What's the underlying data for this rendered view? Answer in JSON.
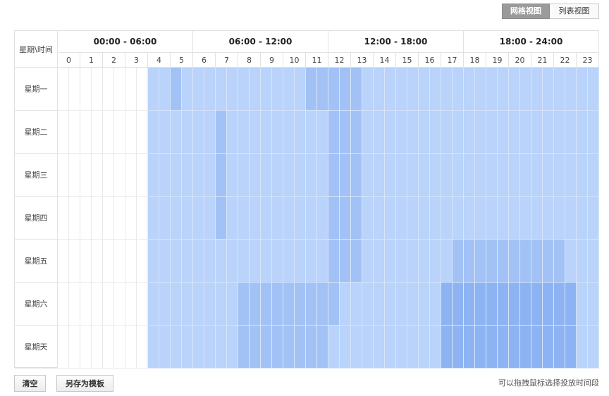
{
  "view_toggle": {
    "grid_label": "网格视图",
    "list_label": "列表视图"
  },
  "grid": {
    "corner_label": "星期\\时间",
    "groups": [
      "00:00 - 06:00",
      "06:00 - 12:00",
      "12:00 - 18:00",
      "18:00 - 24:00"
    ],
    "hours": [
      "0",
      "1",
      "2",
      "3",
      "4",
      "5",
      "6",
      "7",
      "8",
      "9",
      "10",
      "11",
      "12",
      "13",
      "14",
      "15",
      "16",
      "17",
      "18",
      "19",
      "20",
      "21",
      "22",
      "23"
    ],
    "days": [
      "星期一",
      "星期二",
      "星期三",
      "星期四",
      "星期五",
      "星期六",
      "星期天"
    ],
    "shade_levels": {
      "0": "#ffffff",
      "1": "#b9d3fa",
      "2": "#a2c2f6",
      "3": "#8db3f3"
    },
    "shading": [
      [
        0,
        0,
        0,
        0,
        0,
        0,
        0,
        0,
        1,
        1,
        2,
        1,
        1,
        1,
        1,
        1,
        1,
        1,
        1,
        1,
        1,
        1,
        2,
        2,
        2,
        2,
        2,
        1,
        1,
        1,
        1,
        1,
        1,
        1,
        1,
        1,
        1,
        1,
        1,
        1,
        1,
        1,
        1,
        1,
        1,
        1,
        1,
        1
      ],
      [
        0,
        0,
        0,
        0,
        0,
        0,
        0,
        0,
        1,
        1,
        1,
        1,
        1,
        1,
        2,
        1,
        1,
        1,
        1,
        1,
        1,
        1,
        1,
        1,
        2,
        2,
        2,
        1,
        1,
        1,
        1,
        1,
        1,
        1,
        1,
        1,
        1,
        1,
        1,
        1,
        1,
        1,
        1,
        1,
        1,
        1,
        1,
        1
      ],
      [
        0,
        0,
        0,
        0,
        0,
        0,
        0,
        0,
        1,
        1,
        1,
        1,
        1,
        1,
        2,
        1,
        1,
        1,
        1,
        1,
        1,
        1,
        1,
        1,
        2,
        2,
        2,
        1,
        1,
        1,
        1,
        1,
        1,
        1,
        1,
        1,
        1,
        1,
        1,
        1,
        1,
        1,
        1,
        1,
        1,
        1,
        1,
        1
      ],
      [
        0,
        0,
        0,
        0,
        0,
        0,
        0,
        0,
        1,
        1,
        1,
        1,
        1,
        1,
        2,
        1,
        1,
        1,
        1,
        1,
        1,
        1,
        1,
        1,
        2,
        2,
        2,
        1,
        1,
        1,
        1,
        1,
        1,
        1,
        1,
        1,
        1,
        1,
        1,
        1,
        1,
        1,
        1,
        1,
        1,
        1,
        1,
        1
      ],
      [
        0,
        0,
        0,
        0,
        0,
        0,
        0,
        0,
        1,
        1,
        1,
        1,
        1,
        1,
        1,
        1,
        1,
        1,
        1,
        1,
        1,
        1,
        1,
        1,
        2,
        2,
        2,
        1,
        1,
        1,
        1,
        1,
        1,
        1,
        1,
        2,
        2,
        2,
        2,
        2,
        2,
        2,
        2,
        2,
        2,
        1,
        1,
        1
      ],
      [
        0,
        0,
        0,
        0,
        0,
        0,
        0,
        0,
        1,
        1,
        1,
        1,
        1,
        1,
        1,
        1,
        2,
        2,
        2,
        2,
        2,
        2,
        2,
        2,
        2,
        1,
        1,
        1,
        1,
        1,
        1,
        1,
        1,
        1,
        3,
        3,
        3,
        3,
        3,
        3,
        3,
        3,
        3,
        3,
        3,
        3,
        1,
        1
      ],
      [
        0,
        0,
        0,
        0,
        0,
        0,
        0,
        0,
        1,
        1,
        1,
        1,
        1,
        1,
        1,
        1,
        2,
        2,
        2,
        2,
        2,
        2,
        2,
        2,
        1,
        1,
        1,
        1,
        1,
        1,
        1,
        1,
        1,
        1,
        3,
        3,
        3,
        3,
        3,
        3,
        3,
        3,
        3,
        3,
        3,
        3,
        1,
        1
      ]
    ]
  },
  "actions": {
    "clear_label": "清空",
    "save_template_label": "另存为模板"
  },
  "hint": "可以拖拽鼠标选择投放时间段"
}
